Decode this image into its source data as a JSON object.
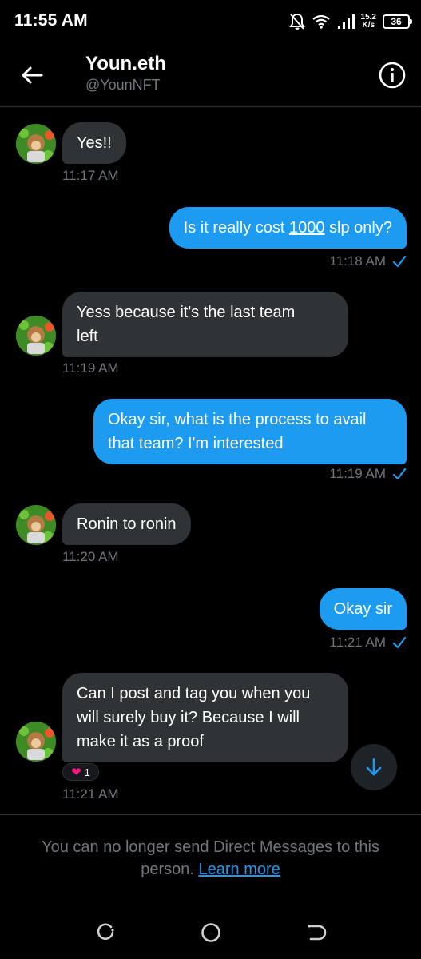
{
  "status_bar": {
    "time": "11:55 AM",
    "net_speed_value": "15.2",
    "net_speed_unit": "K/s",
    "battery": "36"
  },
  "header": {
    "display_name": "Youn.eth",
    "handle": "@YounNFT"
  },
  "messages": [
    {
      "dir": "in",
      "text": "Yes!!",
      "time": "11:17 AM"
    },
    {
      "dir": "out",
      "text_before": "Is it really cost ",
      "text_link": "1000",
      "text_after": " slp only?",
      "time": "11:18 AM"
    },
    {
      "dir": "in",
      "lines": [
        "Yess because it's the last team",
        "left"
      ],
      "time": "11:19 AM"
    },
    {
      "dir": "out",
      "lines": [
        "Okay sir, what is the process to avail",
        "that team? I'm interested"
      ],
      "time": "11:19 AM"
    },
    {
      "dir": "in",
      "text": "Ronin to ronin",
      "time": "11:20 AM"
    },
    {
      "dir": "out",
      "text": "Okay sir",
      "time": "11:21 AM"
    },
    {
      "dir": "in",
      "lines": [
        "Can I post and tag you when you",
        "will surely buy it? Because I will",
        "make it as a proof"
      ],
      "time": "11:21 AM",
      "reaction_count": "1"
    }
  ],
  "footer": {
    "notice_line1": "You can no longer send Direct Messages to this",
    "notice_line2": "person.",
    "learn_more": "Learn more"
  },
  "colors": {
    "accent": "#1d9bf0",
    "incoming_bubble": "#2f3336",
    "muted_text": "#71767b",
    "heart": "#f91880"
  },
  "icons": [
    "bell-off-icon",
    "wifi-icon",
    "signal-icon",
    "battery-icon",
    "back-arrow-icon",
    "info-icon",
    "read-check-icon",
    "heart-icon",
    "arrow-down-icon",
    "recents-icon",
    "home-icon",
    "back-nav-icon"
  ]
}
